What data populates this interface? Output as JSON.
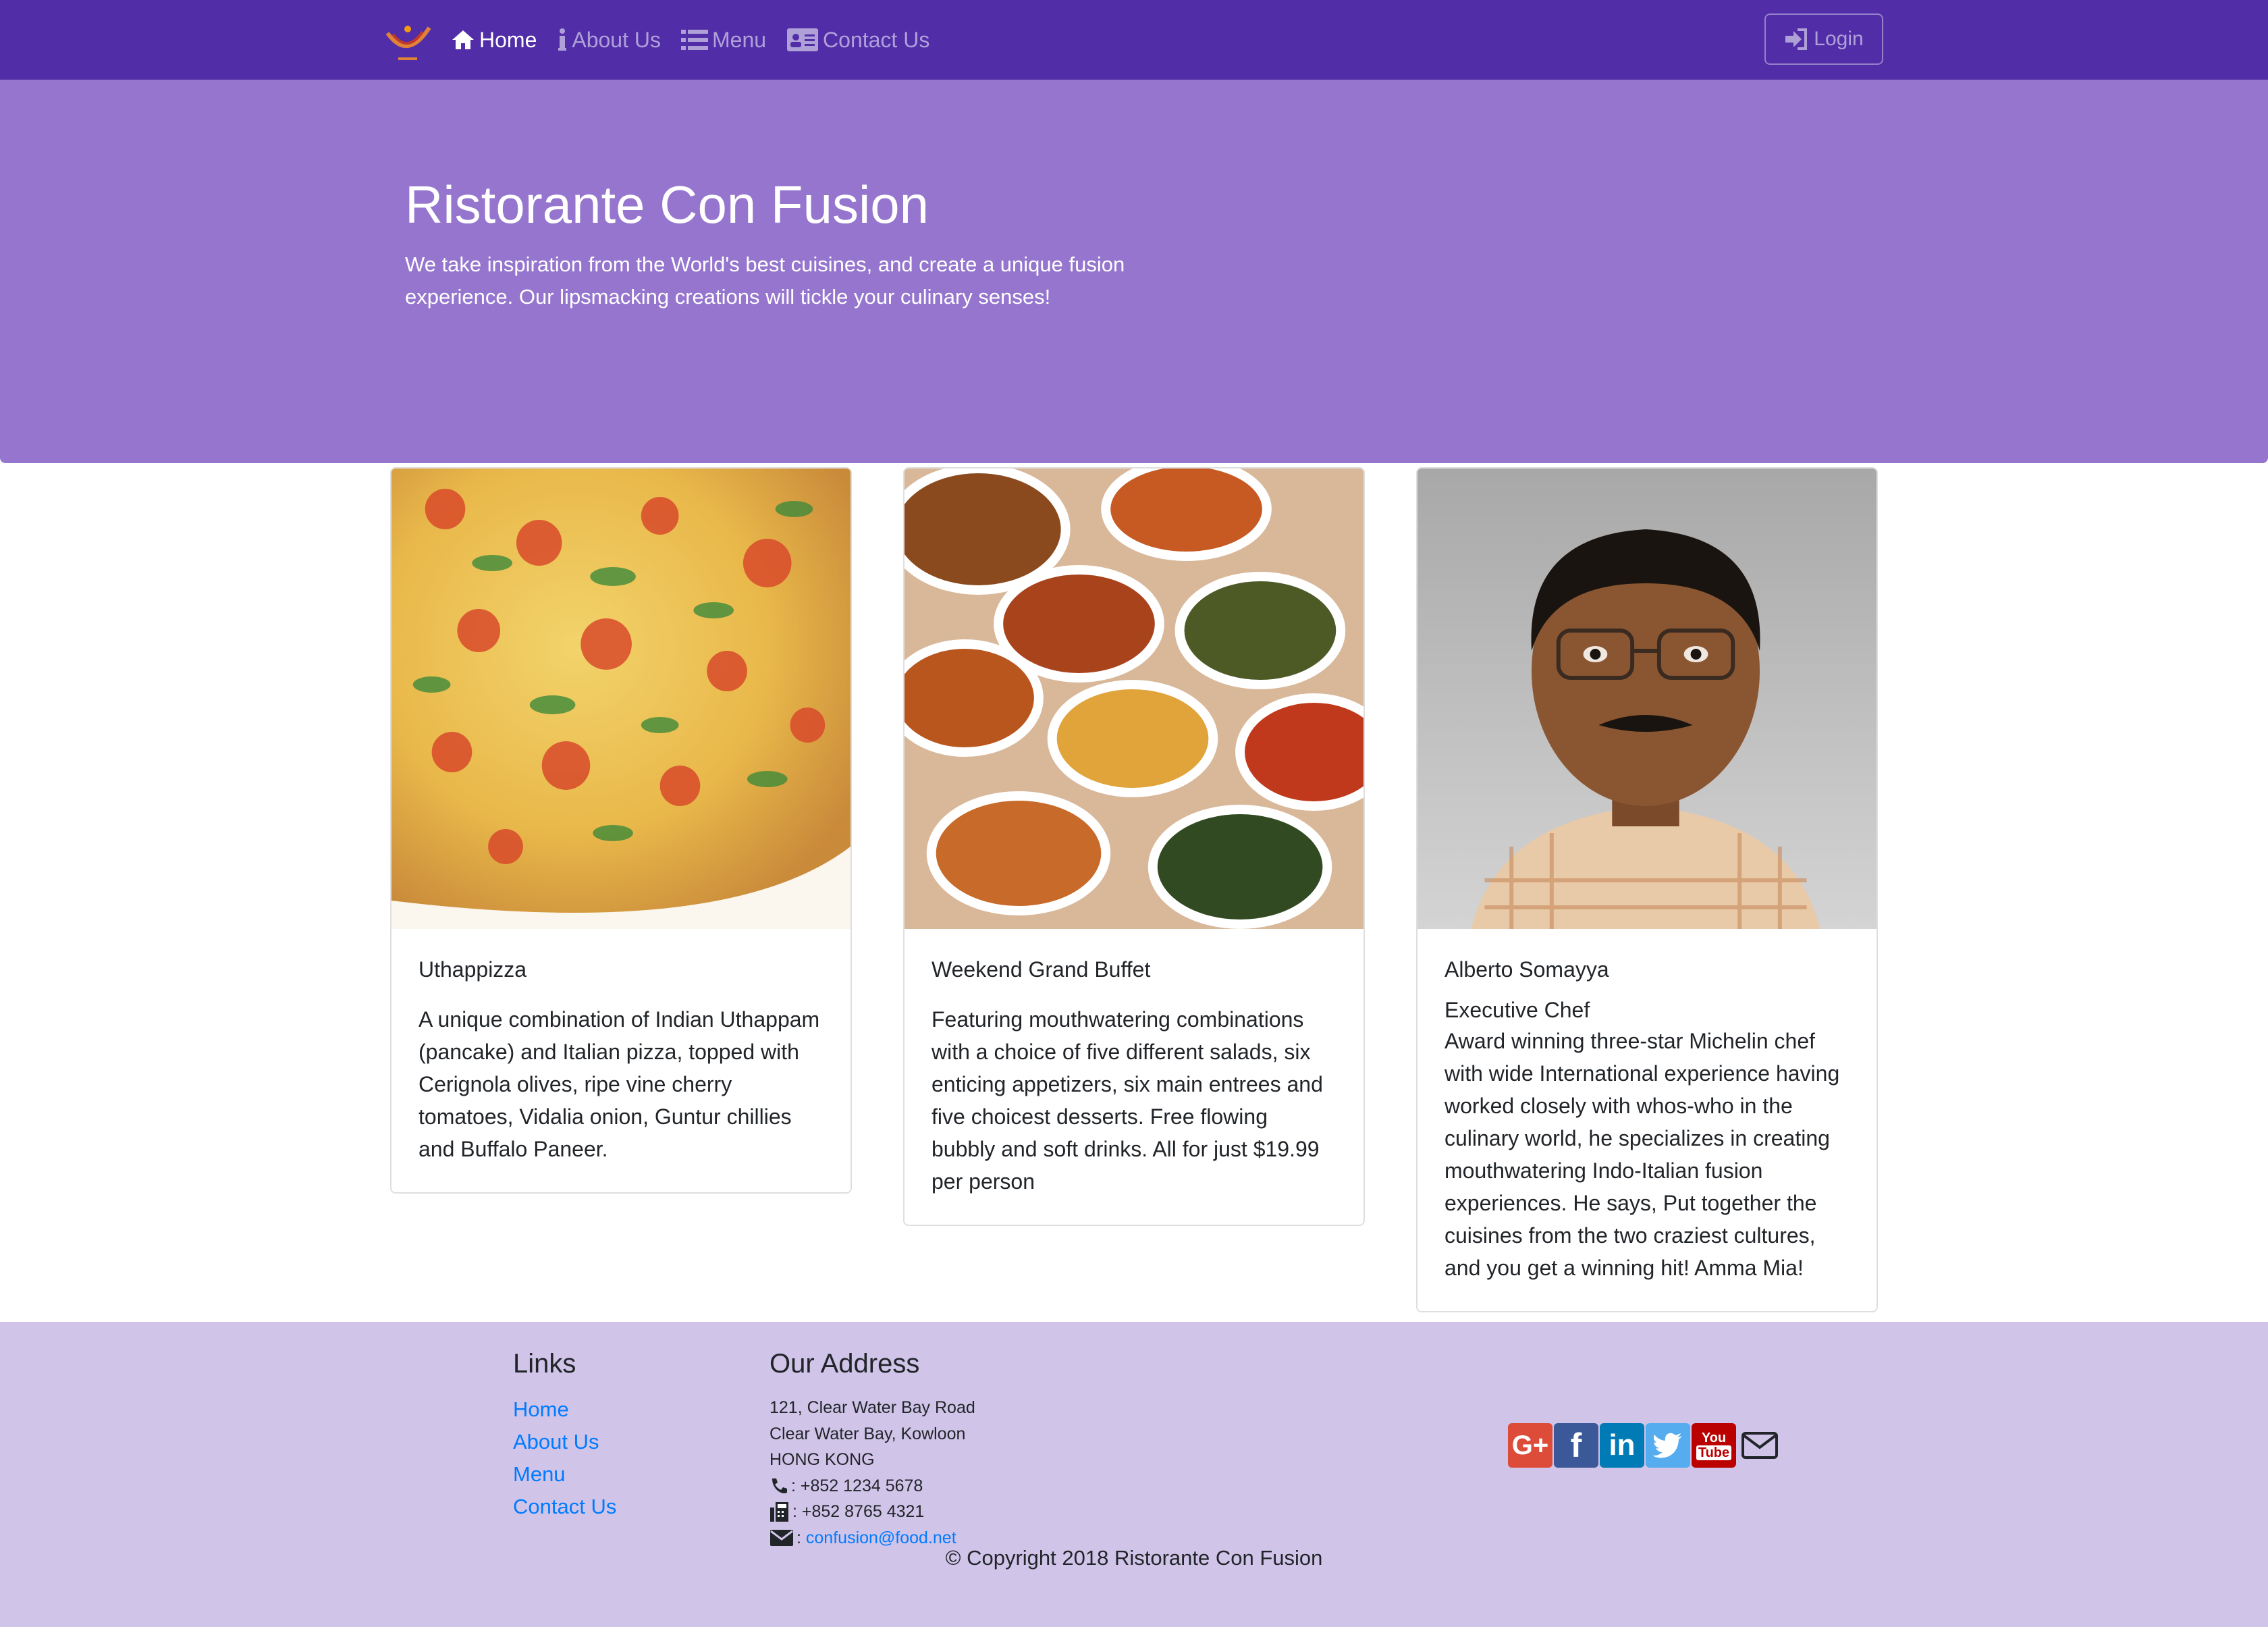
{
  "navbar": {
    "items": [
      {
        "label": "Home"
      },
      {
        "label": "About Us"
      },
      {
        "label": "Menu"
      },
      {
        "label": "Contact Us"
      }
    ],
    "login_label": "Login"
  },
  "jumbotron": {
    "title": "Ristorante Con Fusion",
    "text": "We take inspiration from the World's best cuisines, and create a unique fusion experience. Our lipsmacking creations will tickle your culinary senses!"
  },
  "cards": [
    {
      "title": "Uthappizza",
      "text": "A unique combination of Indian Uthappam (pancake) and Italian pizza, topped with Cerignola olives, ripe vine cherry tomatoes, Vidalia onion, Guntur chillies and Buffalo Paneer."
    },
    {
      "title": "Weekend Grand Buffet",
      "text": "Featuring mouthwatering combinations with a choice of five different salads, six enticing appetizers, six main entrees and five choicest desserts. Free flowing bubbly and soft drinks. All for just $19.99 per person"
    },
    {
      "title": "Alberto Somayya",
      "subtitle": "Executive Chef",
      "text": "Award winning three-star Michelin chef with wide International experience having worked closely with whos-who in the culinary world, he specializes in creating mouthwatering Indo-Italian fusion experiences. He says, Put together the cuisines from the two craziest cultures, and you get a winning hit! Amma Mia!"
    }
  ],
  "footer": {
    "links_heading": "Links",
    "links": [
      "Home",
      "About Us",
      "Menu",
      "Contact Us"
    ],
    "address_heading": "Our Address",
    "address_lines": [
      "121, Clear Water Bay Road",
      "Clear Water Bay, Kowloon",
      "HONG KONG"
    ],
    "phone": ": +852 1234 5678",
    "fax": ": +852 8765 4321",
    "email_prefix": ":",
    "email": "confusion@food.net",
    "social": [
      "google-plus",
      "facebook",
      "linkedin",
      "twitter",
      "youtube",
      "envelope"
    ],
    "copyright": "© Copyright 2018 Ristorante Con Fusion"
  },
  "colors": {
    "navbar": "#512DA8",
    "jumbotron": "#9575CD",
    "footer": "#D1C4E9",
    "link": "#007bff"
  }
}
